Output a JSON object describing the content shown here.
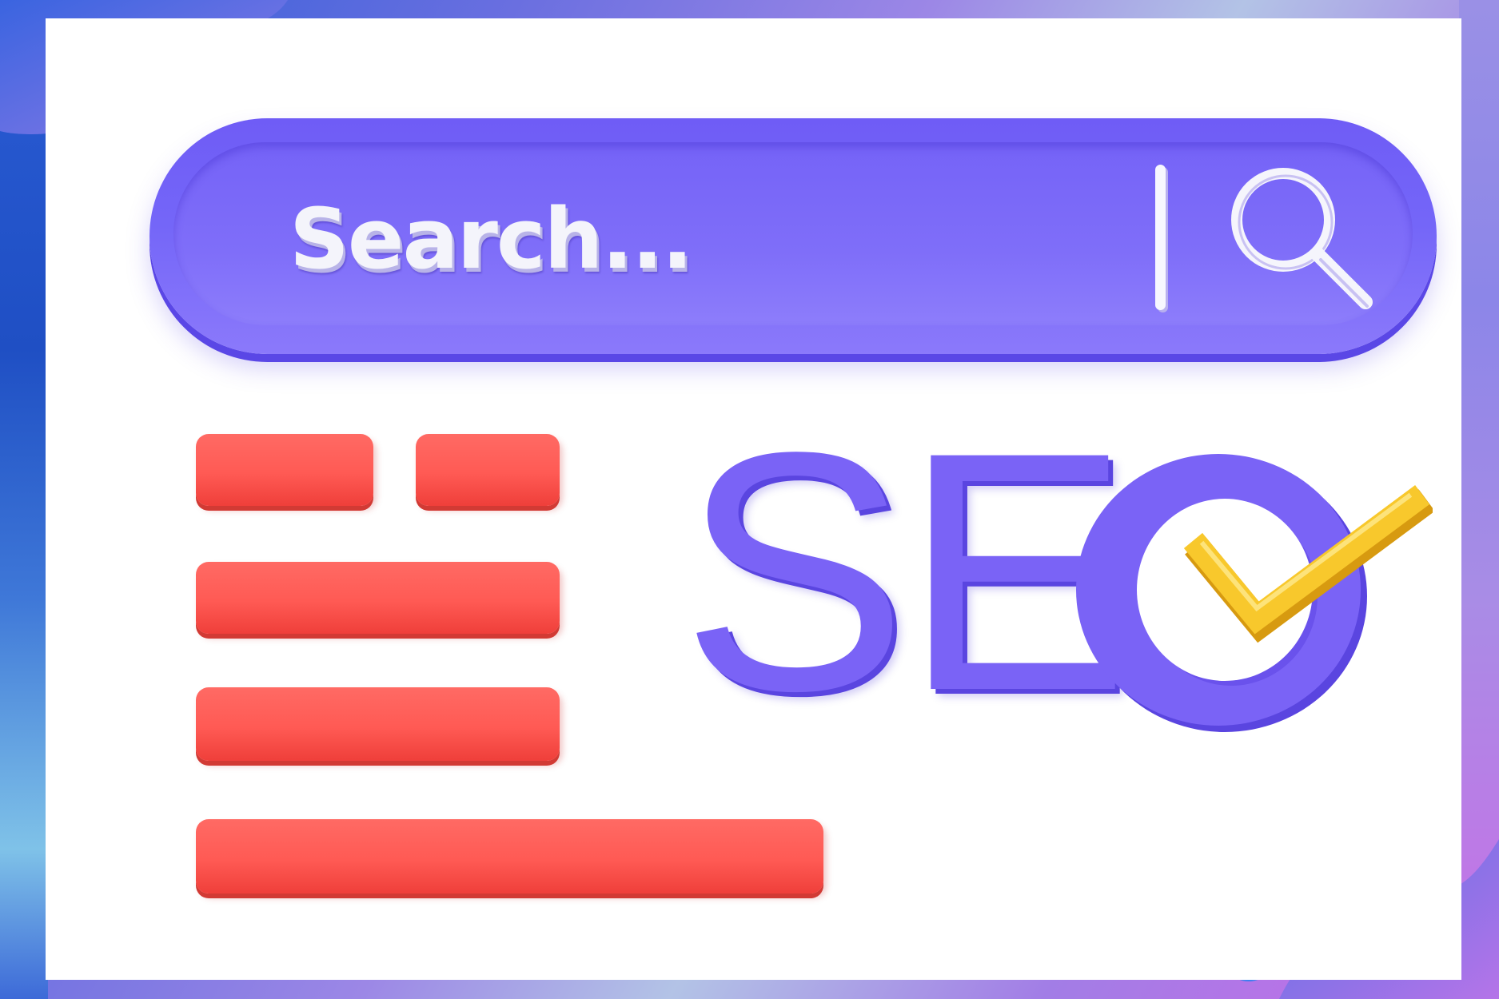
{
  "search_bar": {
    "placeholder": "Search...",
    "icon": "magnifier-icon"
  },
  "logo": {
    "letters": "SE",
    "ring_letter": "O",
    "badge_icon": "checkmark-icon"
  },
  "list": {
    "rows": 5,
    "icon": "text-lines"
  },
  "colors": {
    "search_bar": "#7466f8",
    "bars": "#ff5a54",
    "seo": "#7a63f6",
    "check": "#f7c52a",
    "background": "#ffffff"
  }
}
